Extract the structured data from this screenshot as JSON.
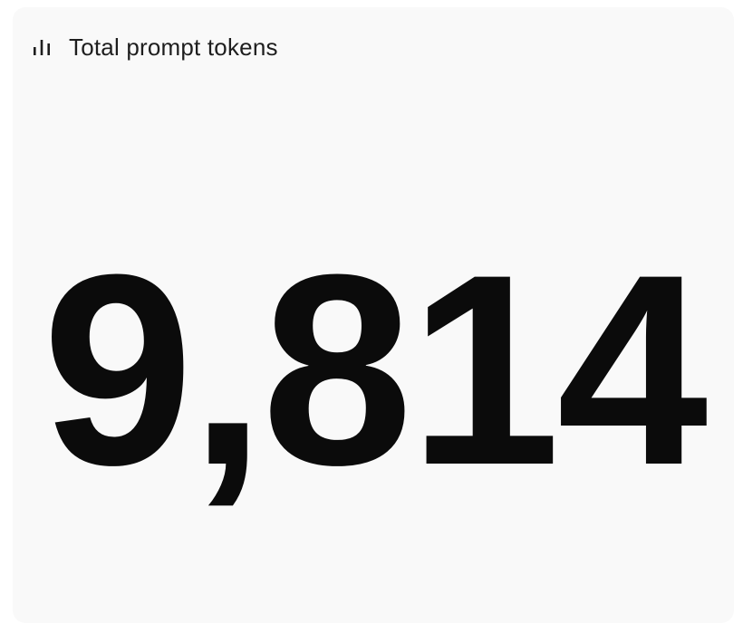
{
  "card": {
    "title": "Total prompt tokens",
    "icon": "bar-chart-icon",
    "value": "9,814"
  },
  "colors": {
    "card_background": "#f9f9f9",
    "text_primary": "#0b0b0b",
    "title_text": "#1e1e1e"
  }
}
